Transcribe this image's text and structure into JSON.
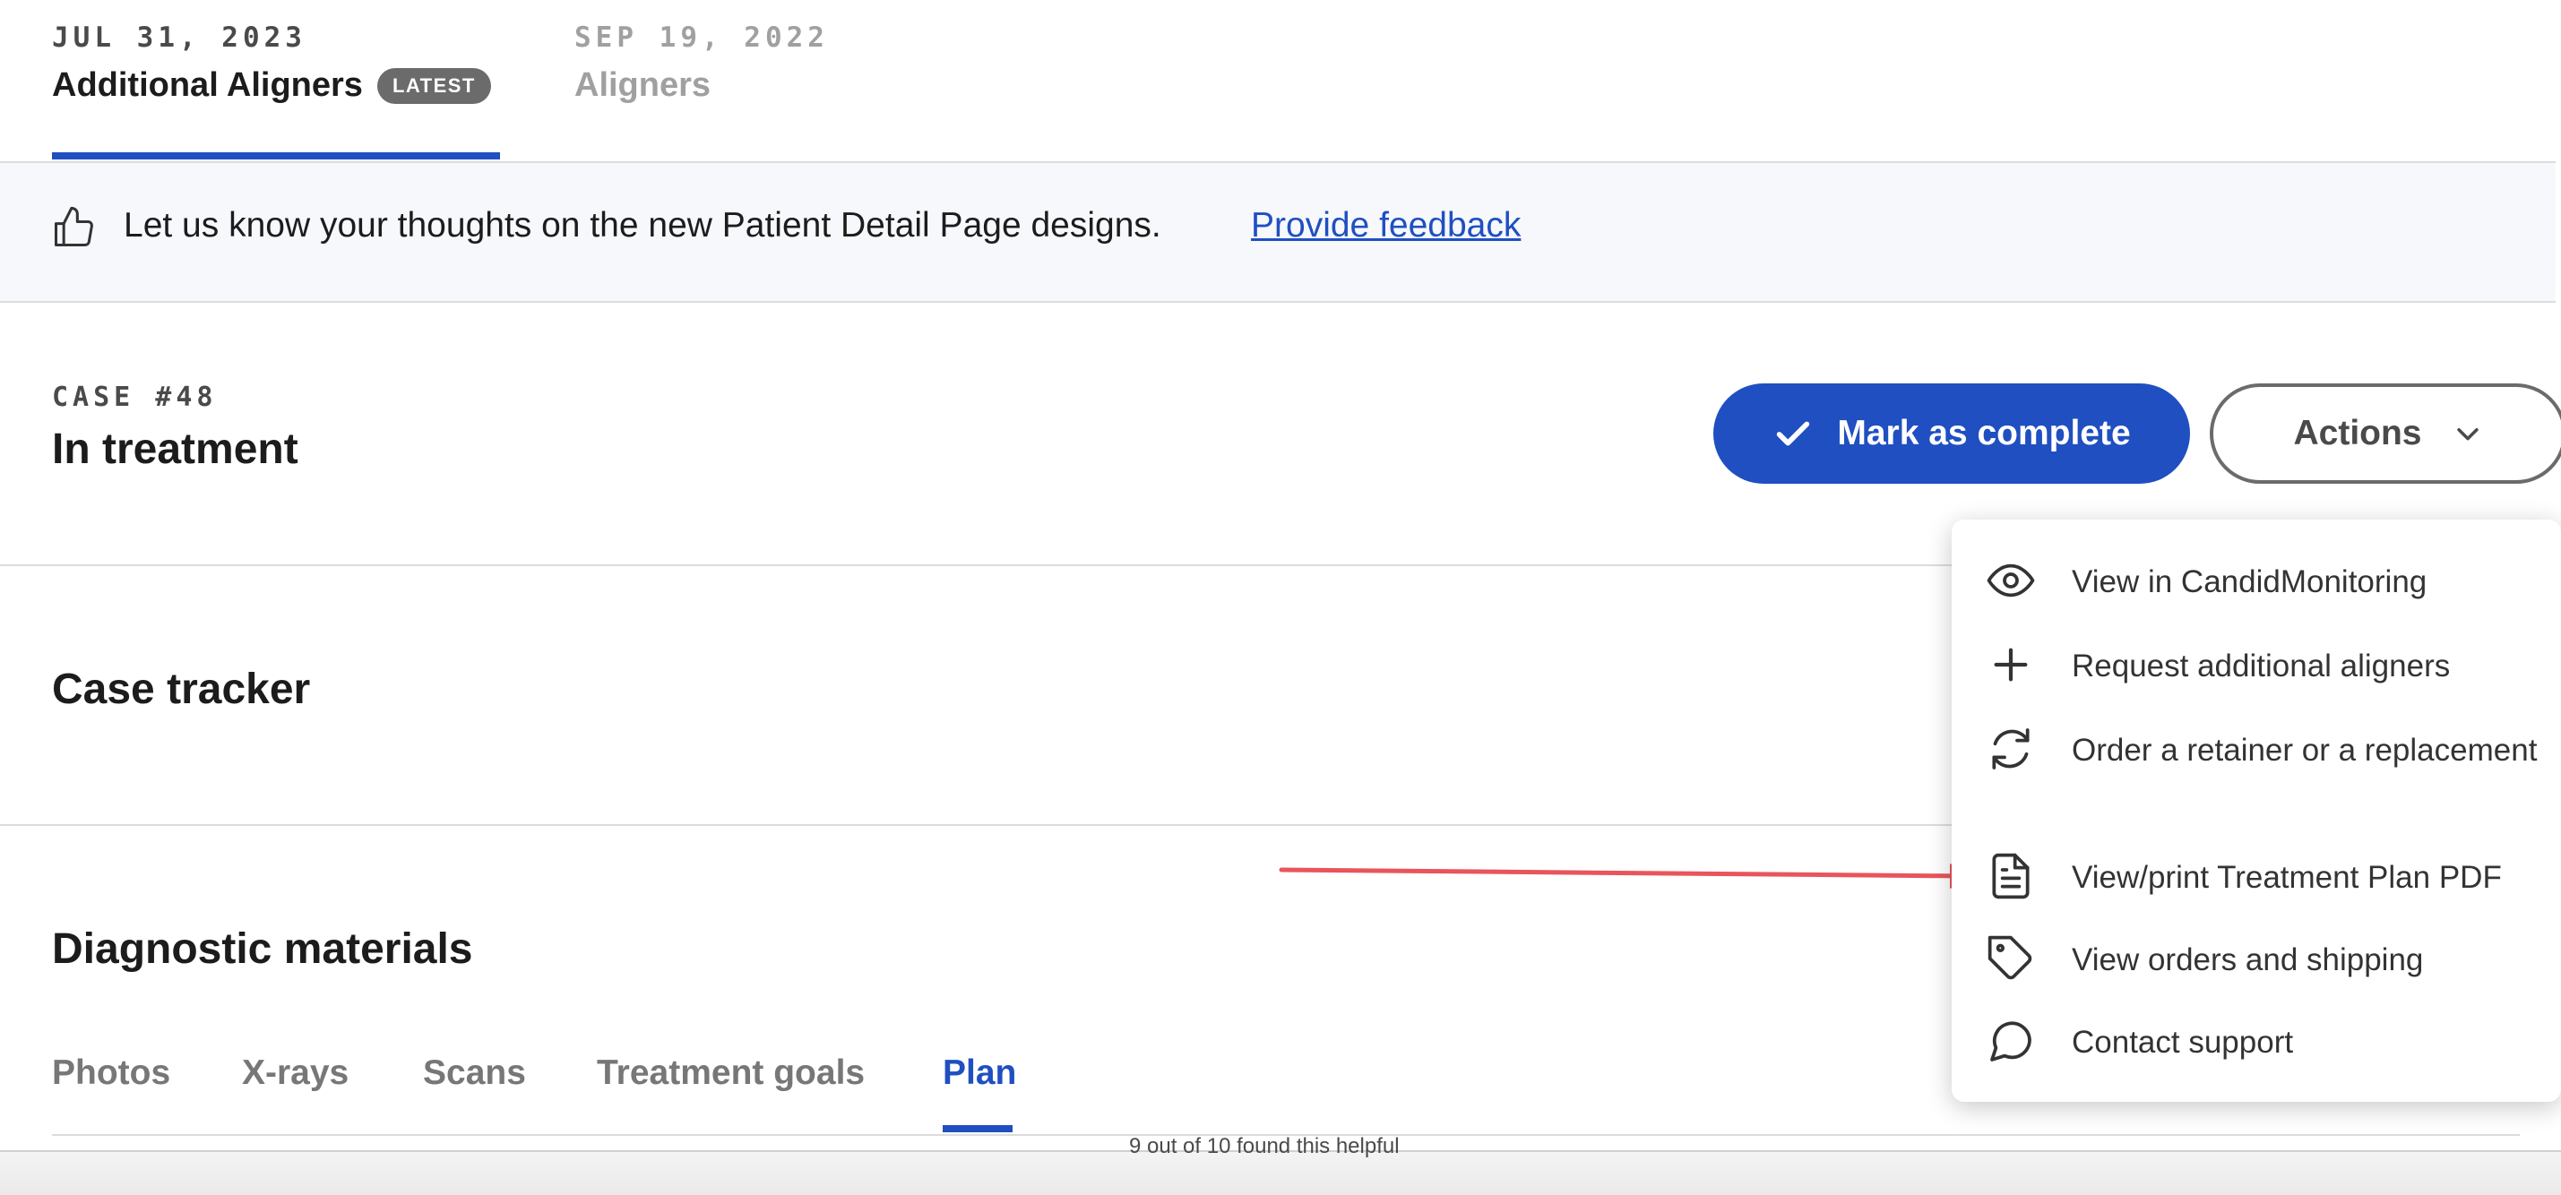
{
  "case_tabs": [
    {
      "date": "JUL 31, 2023",
      "name": "Additional Aligners",
      "badge": "LATEST"
    },
    {
      "date": "SEP 19, 2022",
      "name": "Aligners"
    }
  ],
  "feedback": {
    "message": "Let us know your thoughts on the new Patient Detail Page designs.",
    "link_label": "Provide feedback",
    "icon": "thumbs-up-icon"
  },
  "case": {
    "number": "CASE #48",
    "status": "In treatment"
  },
  "buttons": {
    "mark_complete": "Mark as complete",
    "actions": "Actions"
  },
  "actions_menu": {
    "items": [
      {
        "label": "View in CandidMonitoring",
        "icon": "eye-icon"
      },
      {
        "label": "Request additional aligners",
        "icon": "plus-icon"
      },
      {
        "label": "Order a retainer or a replacement",
        "icon": "refresh-icon"
      },
      {
        "label": "View/print Treatment Plan PDF",
        "icon": "document-icon"
      },
      {
        "label": "View orders and shipping",
        "icon": "tag-icon"
      },
      {
        "label": "Contact support",
        "icon": "chat-bubble-icon"
      }
    ]
  },
  "sections": {
    "case_tracker": "Case tracker",
    "diagnostic_materials": "Diagnostic materials"
  },
  "material_tabs": [
    {
      "label": "Photos"
    },
    {
      "label": "X-rays"
    },
    {
      "label": "Scans"
    },
    {
      "label": "Treatment goals"
    },
    {
      "label": "Plan",
      "active": true
    }
  ],
  "footer": {
    "helpful_text": "9 out of 10 found this helpful"
  },
  "colors": {
    "primary": "#1f4fc1",
    "annotation_arrow": "#e8555b",
    "banner_bg": "#f6f8fc"
  }
}
